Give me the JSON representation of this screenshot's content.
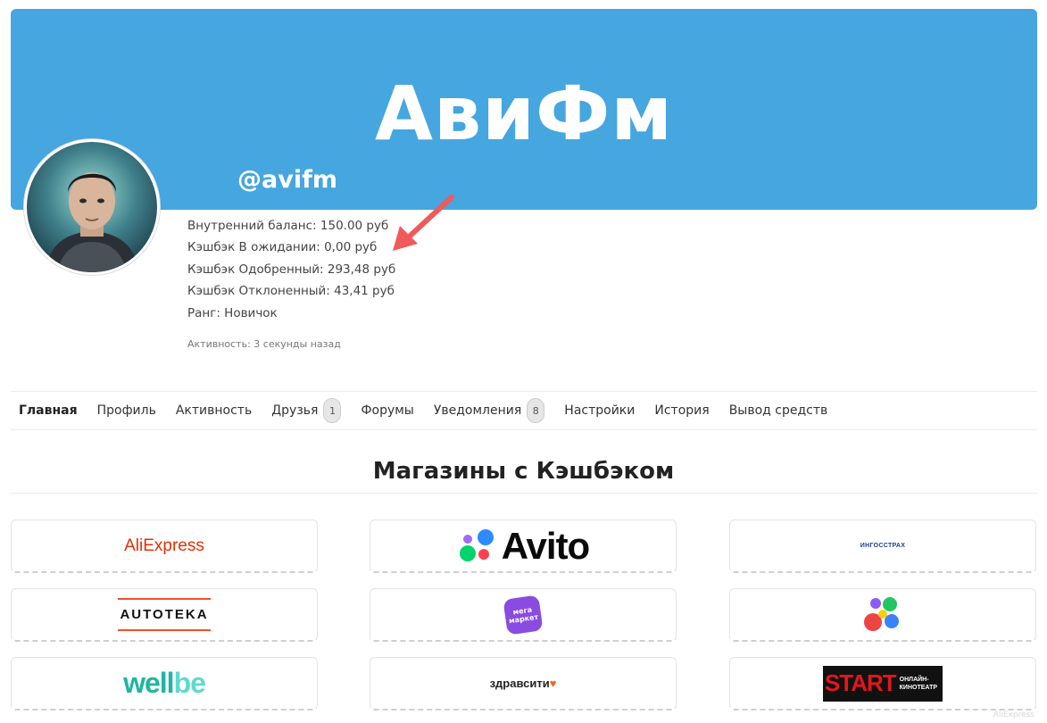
{
  "cover": {
    "title": "АвиФм",
    "username": "@avifm",
    "color": "#45a6e0"
  },
  "stats": {
    "balance": "Внутренний баланс: 150.00 руб",
    "pending": "Кэшбэк В ожидании: 0,00 руб",
    "approved": "Кэшбэк Одобренный: 293,48 руб",
    "rejected": "Кэшбэк Отклоненный: 43,41 руб",
    "rank": "Ранг: Новичок"
  },
  "activity": "Активность: 3 секунды назад",
  "nav": {
    "items": [
      {
        "label": "Главная"
      },
      {
        "label": "Профиль"
      },
      {
        "label": "Активность"
      },
      {
        "label": "Друзья",
        "badge": "1"
      },
      {
        "label": "Форумы"
      },
      {
        "label": "Уведомления",
        "badge": "8"
      },
      {
        "label": "Настройки"
      },
      {
        "label": "История"
      },
      {
        "label": "Вывод средств"
      }
    ]
  },
  "section": {
    "title": "Магазины с Кэшбэком"
  },
  "shops": {
    "aliexpress": "AliExpress",
    "avito": "Avito",
    "ingos": "ИНГОССТРАХ",
    "autoteka": "AUTOTEKA",
    "megamarket": "мега маркет",
    "wellbe_1": "well",
    "wellbe_2": "be",
    "zdravcity": "здравсити",
    "start": "START",
    "start_sub_1": "ОНЛАЙН-",
    "start_sub_2": "КИНОТЕАТР"
  },
  "watermark": "AliExpress",
  "colors": {
    "accent": "#45a6e0",
    "arrow": "#f05a5a"
  }
}
